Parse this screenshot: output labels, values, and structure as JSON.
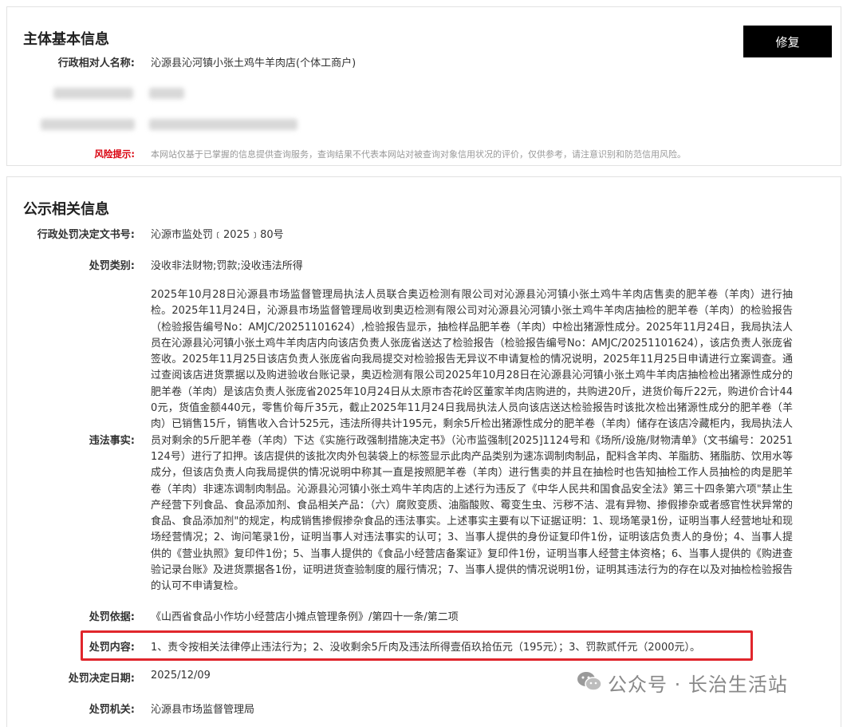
{
  "basic": {
    "title": "主体基本信息",
    "repair_button": "修复",
    "fields": [
      {
        "label": "行政相对人名称:",
        "value": "沁源县沁河镇小张土鸡牛羊肉店(个体工商户)"
      }
    ],
    "risk_label": "风险提示:",
    "risk_text": "本网站仅基于已掌握的信息提供查询服务，查询结果不代表本网站对被查询对象信用状况的评价，仅供参考，请注意识别和防范信用风险。"
  },
  "publicity": {
    "title": "公示相关信息",
    "doc_no_label": "行政处罚决定文书号:",
    "doc_no": "沁源市监处罚﹝2025﹞80号",
    "category_label": "处罚类别:",
    "category": "没收非法财物;罚款;没收违法所得",
    "facts_label": "违法事实:",
    "facts": "2025年10月28日沁源县市场监督管理局执法人员联合奥迈检测有限公司对沁源县沁河镇小张土鸡牛羊肉店售卖的肥羊卷（羊肉）进行抽检。2025年11月24日，沁源县市场监督管理局收到奥迈检测有限公司对沁源县沁河镇小张土鸡牛羊肉店抽检的肥羊卷（羊肉）的检验报告（检验报告编号No：AMJC/20251101624）,检验报告显示，抽检样品肥羊卷（羊肉）中检出猪源性成分。2025年11月24日，我局执法人员在沁源县沁河镇小张土鸡牛羊肉店内向该店负责人张庞省送达了检验报告（检验报告编号No：AMJC/20251101624），该店负责人张庞省签收。2025年11月25日该店负责人张庞省向我局提交对检验报告无异议不申请复检的情况说明，2025年11月25日申请进行立案调查。通过查阅该店进货票据以及购进验收台账记录，奥迈检测有限公司2025年10月28日在沁源县沁河镇小张土鸡牛羊肉店抽检检出猪源性成分的肥羊卷（羊肉）是该店负责人张庞省2025年10月24日从太原市杏花岭区董家羊肉店购进的，共购进20斤，进货价每斤22元，购进价合计440元，货值金额440元，零售价每斤35元，截止2025年11月24日我局执法人员向该店送达检验报告时该批次检出猪源性成分的肥羊卷（羊肉）已销售15斤，销售收入合计525元，违法所得共计195元，剩余5斤检出猪源性成分的肥羊卷（羊肉）储存在该店冷藏柜内，我局执法人员对剩余的5斤肥羊卷（羊肉）下达《实施行政强制措施决定书》（沁市监强制[2025]1124号和《场所/设施/财物清单》（文书编号：20251124号）进行了扣押。该店提供的该批次肉外包装袋上的标签显示此肉产品类别为速冻调制肉制品，配料含羊肉、羊脂肪、猪脂肪、饮用水等成分，但该店负责人向我局提供的情况说明中称其一直是按照肥羊卷（羊肉）进行售卖的并且在抽检时也告知抽检工作人员抽检的肉是肥羊卷（羊肉）非速冻调制肉制品。沁源县沁河镇小张土鸡牛羊肉店的上述行为违反了《中华人民共和国食品安全法》第三十四条第六项\"禁止生产经营下列食品、食品添加剂、食品相关产品：（六）腐败变质、油脂酸败、霉变生虫、污秽不洁、混有异物、掺假掺杂或者感官性状异常的食品、食品添加剂\"的规定，构成销售掺假掺杂食品的违法事实。上述事实主要有以下证据证明：1、现场笔录1份，证明当事人经营地址和现场经营情况；2、询问笔录1份，证明当事人对违法事实的认可；3、当事人提供的身份证复印件1份，证明该店负责人的身份；4、当事人提供的《营业执照》复印件1份；5、当事人提供的《食品小经营店备案证》复印件1份，证明当事人经营主体资格；6、当事人提供的《购进查验记录台账》及进货票据各1份，证明进货查验制度的履行情况；7、当事人提供的情况说明1份，证明其违法行为的存在以及对抽检检验报告的认可不申请复检。",
    "basis_label": "处罚依据:",
    "basis": "《山西省食品小作坊小经营店小摊点管理条例》/第四十一条/第二项",
    "content_label": "处罚内容:",
    "content": "1、责令按相关法律停止违法行为；2、没收剩余5斤肉及违法所得壹佰玖拾伍元（195元）；3、罚款贰仟元（2000元）。",
    "date_label": "处罚决定日期:",
    "date": "2025/12/09",
    "org_label": "处罚机关:",
    "org": "沁源县市场监督管理局"
  },
  "watermark": "公众号 · 长治生活站",
  "colors": {
    "risk": "#d9000d",
    "highlight_border": "#e0262c",
    "button_bg": "#000000"
  }
}
